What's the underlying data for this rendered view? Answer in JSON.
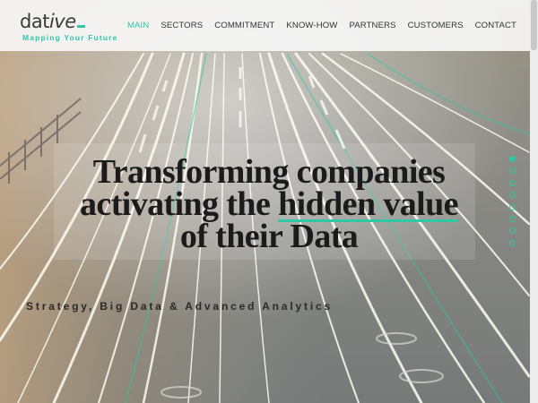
{
  "brand": {
    "name_start": "dat",
    "name_end": "ive",
    "tagline": "Mapping Your Future",
    "accent_color": "#2fc7a4"
  },
  "nav": {
    "items": [
      {
        "label": "MAIN",
        "active": true
      },
      {
        "label": "SECTORS",
        "active": false
      },
      {
        "label": "COMMITMENT",
        "active": false
      },
      {
        "label": "KNOW-HOW",
        "active": false
      },
      {
        "label": "PARTNERS",
        "active": false
      },
      {
        "label": "CUSTOMERS",
        "active": false
      },
      {
        "label": "CONTACT",
        "active": false
      }
    ]
  },
  "hero": {
    "line1": "Transforming companies",
    "line2_start": "activating the",
    "line2_highlight": "hidden value",
    "line3": "of their Data",
    "subtitle": "Strategy, Big Data & Advanced Analytics"
  },
  "section_dots": {
    "count": 8,
    "active_index": 0
  }
}
